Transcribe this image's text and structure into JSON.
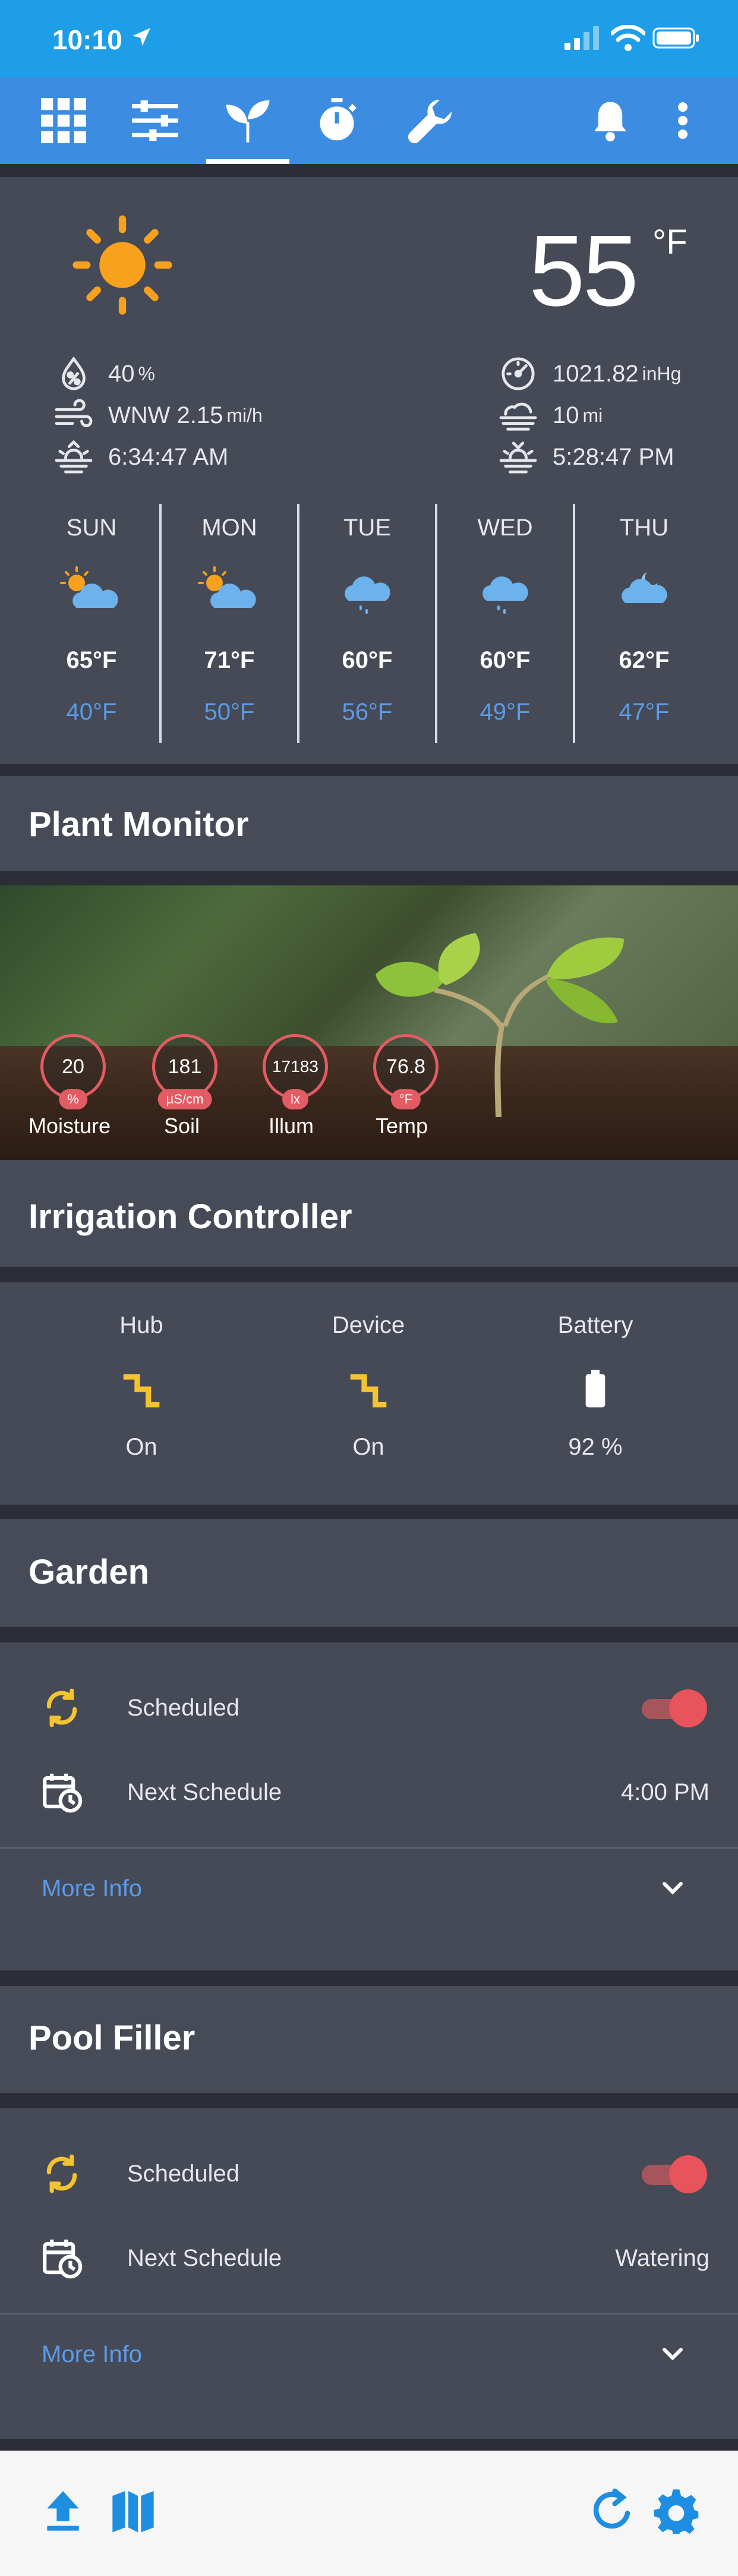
{
  "status_bar": {
    "time": "10:10"
  },
  "toolbar": {
    "tabs": [
      {
        "name": "grid"
      },
      {
        "name": "sliders"
      },
      {
        "name": "plant"
      },
      {
        "name": "timer"
      },
      {
        "name": "wrench"
      }
    ],
    "active_tab": "plant"
  },
  "weather": {
    "temperature": "55",
    "unit": "°F",
    "humidity": "40",
    "humidity_unit": "%",
    "wind": "WNW 2.15",
    "wind_unit": "mi/h",
    "sunrise": "6:34:47 AM",
    "pressure": "1021.82",
    "pressure_unit": "inHg",
    "visibility": "10",
    "visibility_unit": "mi",
    "sunset": "5:28:47 PM",
    "forecast": [
      {
        "day": "SUN",
        "icon": "partly-sunny-icon",
        "high": "65°F",
        "low": "40°F"
      },
      {
        "day": "MON",
        "icon": "partly-sunny-icon",
        "high": "71°F",
        "low": "50°F"
      },
      {
        "day": "TUE",
        "icon": "rain-cloud-icon",
        "high": "60°F",
        "low": "56°F"
      },
      {
        "day": "WED",
        "icon": "rain-cloud-icon",
        "high": "60°F",
        "low": "49°F"
      },
      {
        "day": "THU",
        "icon": "cloudy-night-icon",
        "high": "62°F",
        "low": "47°F"
      }
    ]
  },
  "plant_monitor": {
    "title": "Plant Monitor",
    "gauges": [
      {
        "value": "20",
        "unit": "%",
        "label": "Moisture"
      },
      {
        "value": "181",
        "unit": "µS/cm",
        "label": "Soil"
      },
      {
        "value": "17183",
        "unit": "lx",
        "label": "Illum"
      },
      {
        "value": "76.8",
        "unit": "°F",
        "label": "Temp"
      }
    ]
  },
  "irrigation": {
    "title": "Irrigation Controller",
    "items": [
      {
        "label": "Hub",
        "value": "On",
        "icon": "connection-icon"
      },
      {
        "label": "Device",
        "value": "On",
        "icon": "connection-icon"
      },
      {
        "label": "Battery",
        "value": "92 %",
        "icon": "battery-icon"
      }
    ]
  },
  "garden": {
    "title": "Garden",
    "scheduled_label": "Scheduled",
    "scheduled_on": true,
    "next_label": "Next Schedule",
    "next_value": "4:00 PM",
    "more_info": "More Info"
  },
  "pool_filler": {
    "title": "Pool Filler",
    "scheduled_label": "Scheduled",
    "scheduled_on": true,
    "next_label": "Next Schedule",
    "next_value": "Watering",
    "more_info": "More Info"
  },
  "colors": {
    "status_bar": "#1e9ee8",
    "toolbar": "#3c8de2",
    "accent_blue": "#5b9be8",
    "accent_red": "#e35b63",
    "icon_yellow": "#f5c330"
  }
}
